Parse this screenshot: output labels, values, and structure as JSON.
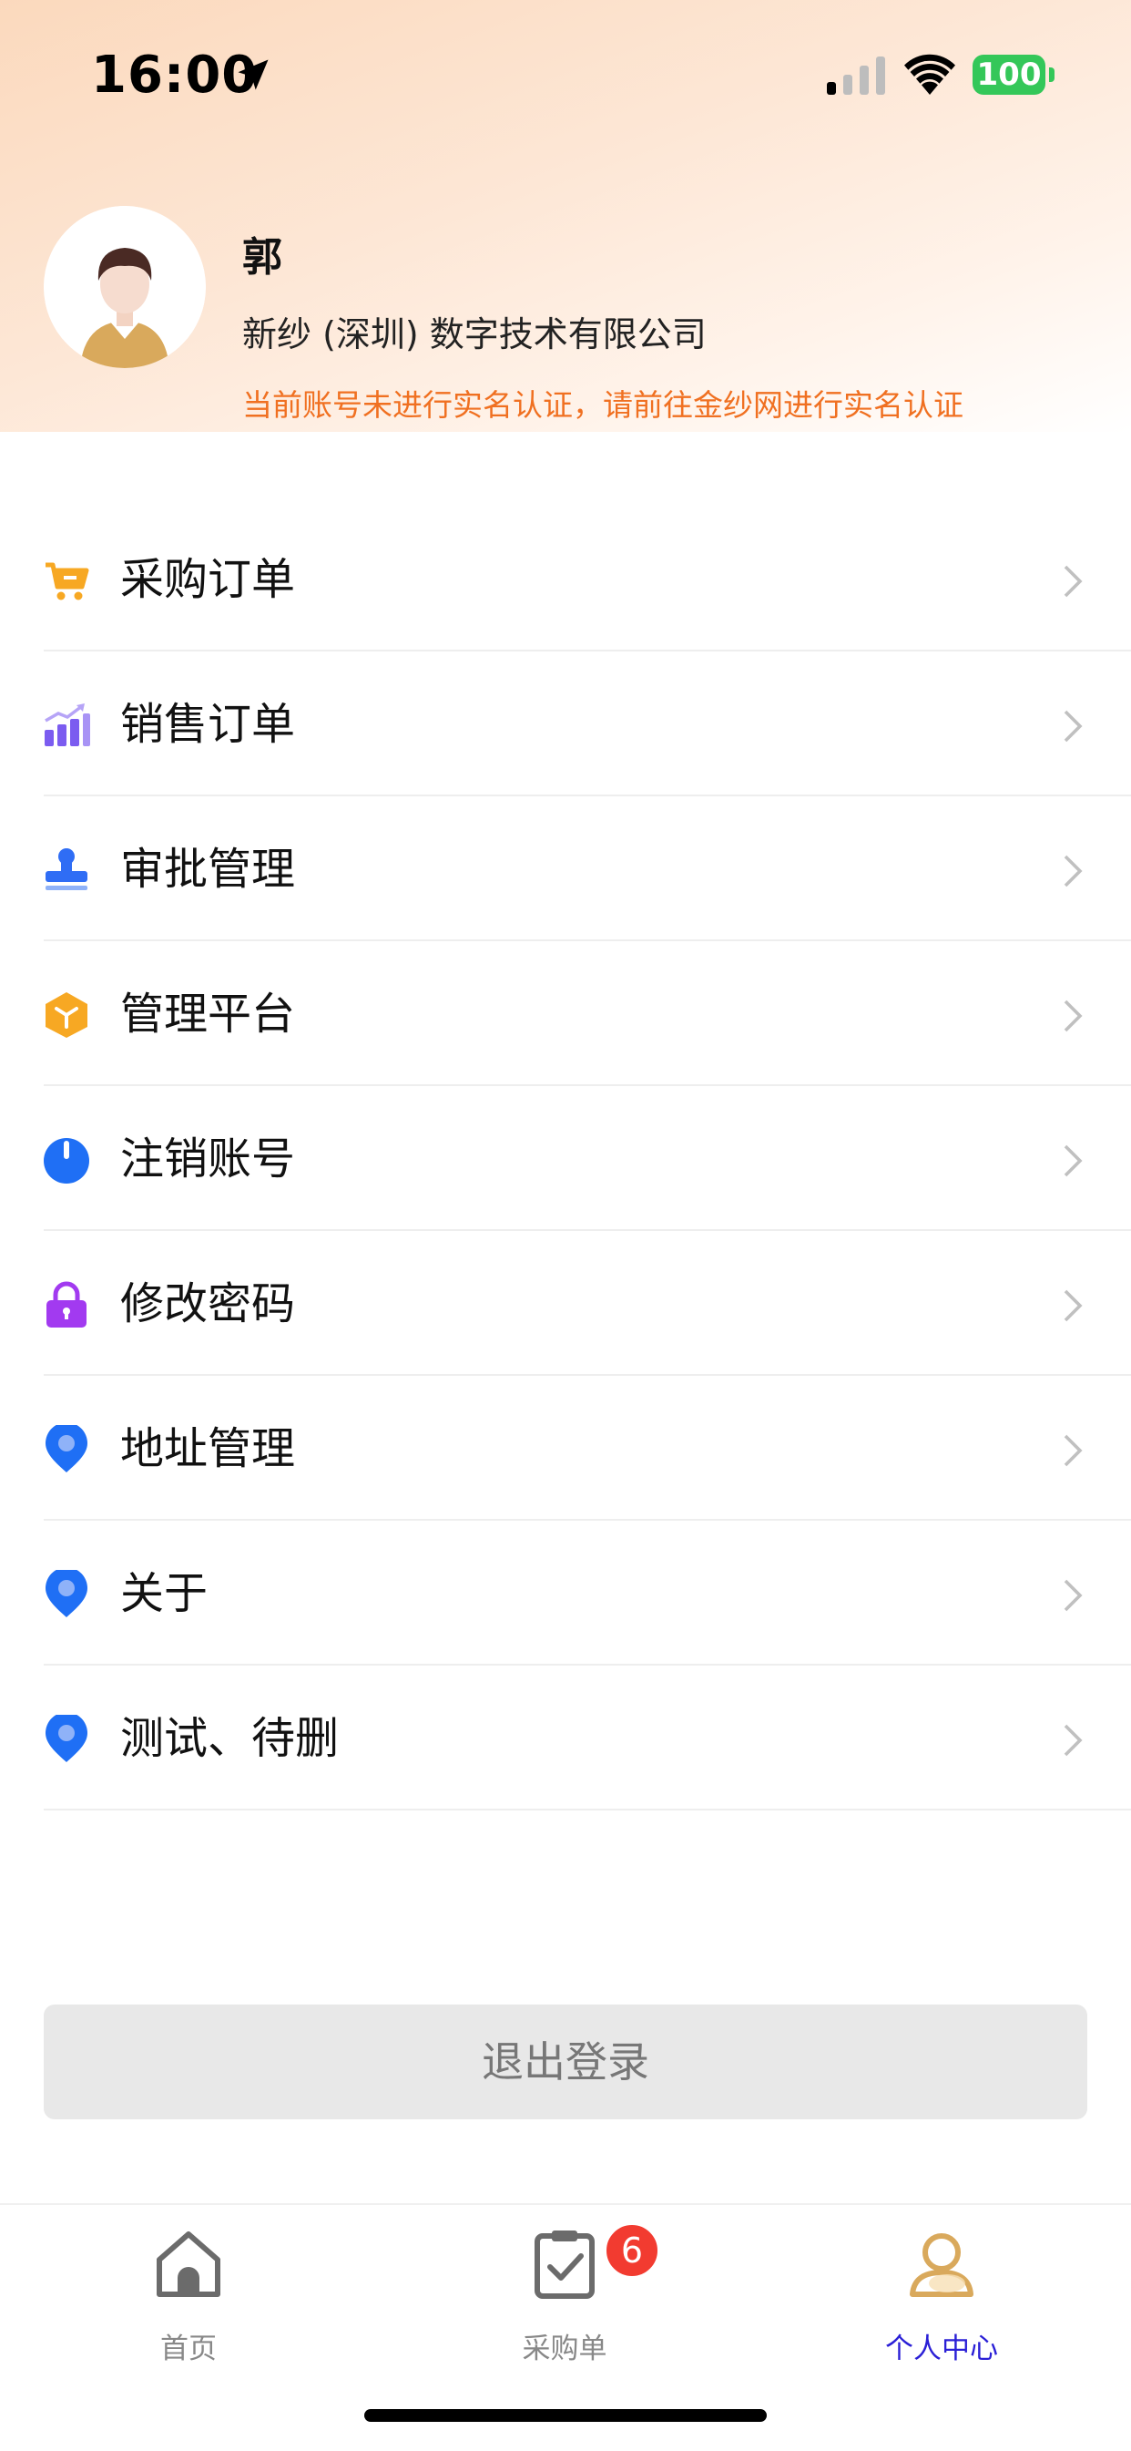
{
  "status_bar": {
    "time": "16:00",
    "battery": "100"
  },
  "profile": {
    "name": "郭",
    "company": "新纱 (深圳) 数字技术有限公司",
    "warning": "当前账号未进行实名认证，请前往金纱网进行实名认证"
  },
  "menu": {
    "items": [
      {
        "label": "采购订单",
        "icon": "cart-icon",
        "color": "#f7a823"
      },
      {
        "label": "销售订单",
        "icon": "bar-chart-icon",
        "color": "#7b5cf0"
      },
      {
        "label": "审批管理",
        "icon": "stamp-icon",
        "color": "#2f6df5"
      },
      {
        "label": "管理平台",
        "icon": "box-icon",
        "color": "#f7a823"
      },
      {
        "label": "注销账号",
        "icon": "power-icon",
        "color": "#1f6ff5"
      },
      {
        "label": "修改密码",
        "icon": "lock-icon",
        "color": "#a23af0"
      },
      {
        "label": "地址管理",
        "icon": "location-pin-icon",
        "color": "#1f6ff5"
      },
      {
        "label": "关于",
        "icon": "location-pin-icon",
        "color": "#1f6ff5"
      },
      {
        "label": "测试、待删",
        "icon": "location-pin-icon",
        "color": "#1f6ff5"
      }
    ]
  },
  "logout_label": "退出登录",
  "tabbar": {
    "tabs": [
      {
        "label": "首页",
        "icon": "home-icon",
        "active": false
      },
      {
        "label": "采购单",
        "icon": "clipboard-check-icon",
        "active": false,
        "badge": "6"
      },
      {
        "label": "个人中心",
        "icon": "person-icon",
        "active": true
      }
    ]
  },
  "colors": {
    "accent": "#2a1fd6",
    "warning": "#f07021",
    "badge": "#f23b30"
  }
}
